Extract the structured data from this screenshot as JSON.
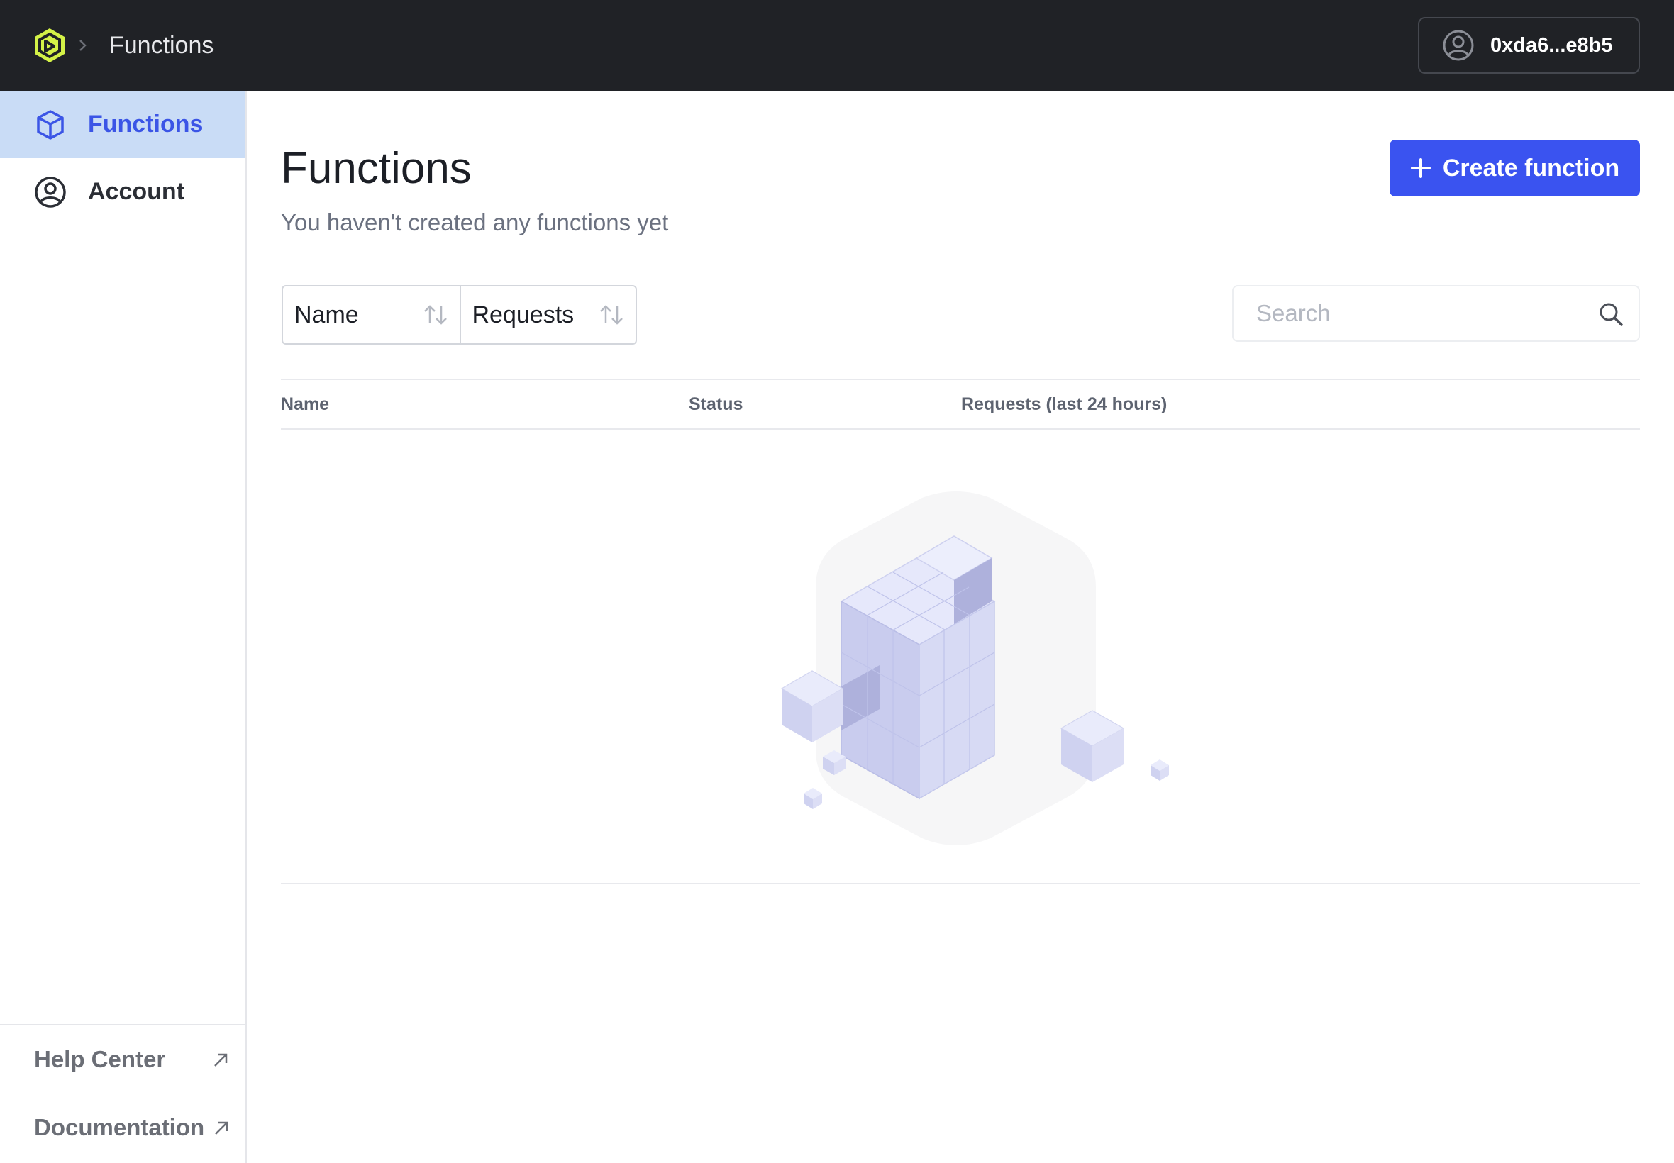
{
  "topbar": {
    "breadcrumb_title": "Functions",
    "account_address": "0xda6...e8b5"
  },
  "sidebar": {
    "items": [
      {
        "label": "Functions",
        "icon": "cube-icon",
        "active": true
      },
      {
        "label": "Account",
        "icon": "user-circle-icon",
        "active": false
      }
    ],
    "links": [
      {
        "label": "Help Center",
        "icon": "external-arrow-icon"
      },
      {
        "label": "Documentation",
        "icon": "external-arrow-icon"
      }
    ]
  },
  "main": {
    "title": "Functions",
    "subtitle": "You haven't created any functions yet",
    "create_button_label": "Create function",
    "sort_buttons": [
      "Name",
      "Requests"
    ],
    "search_placeholder": "Search",
    "table": {
      "columns": [
        "Name",
        "Status",
        "Requests (last 24 hours)"
      ],
      "rows": []
    }
  },
  "colors": {
    "topbar_bg": "#202226",
    "accent": "#3a53f0",
    "active_nav_bg": "#c9dcf6",
    "logo": "#d4f247"
  }
}
